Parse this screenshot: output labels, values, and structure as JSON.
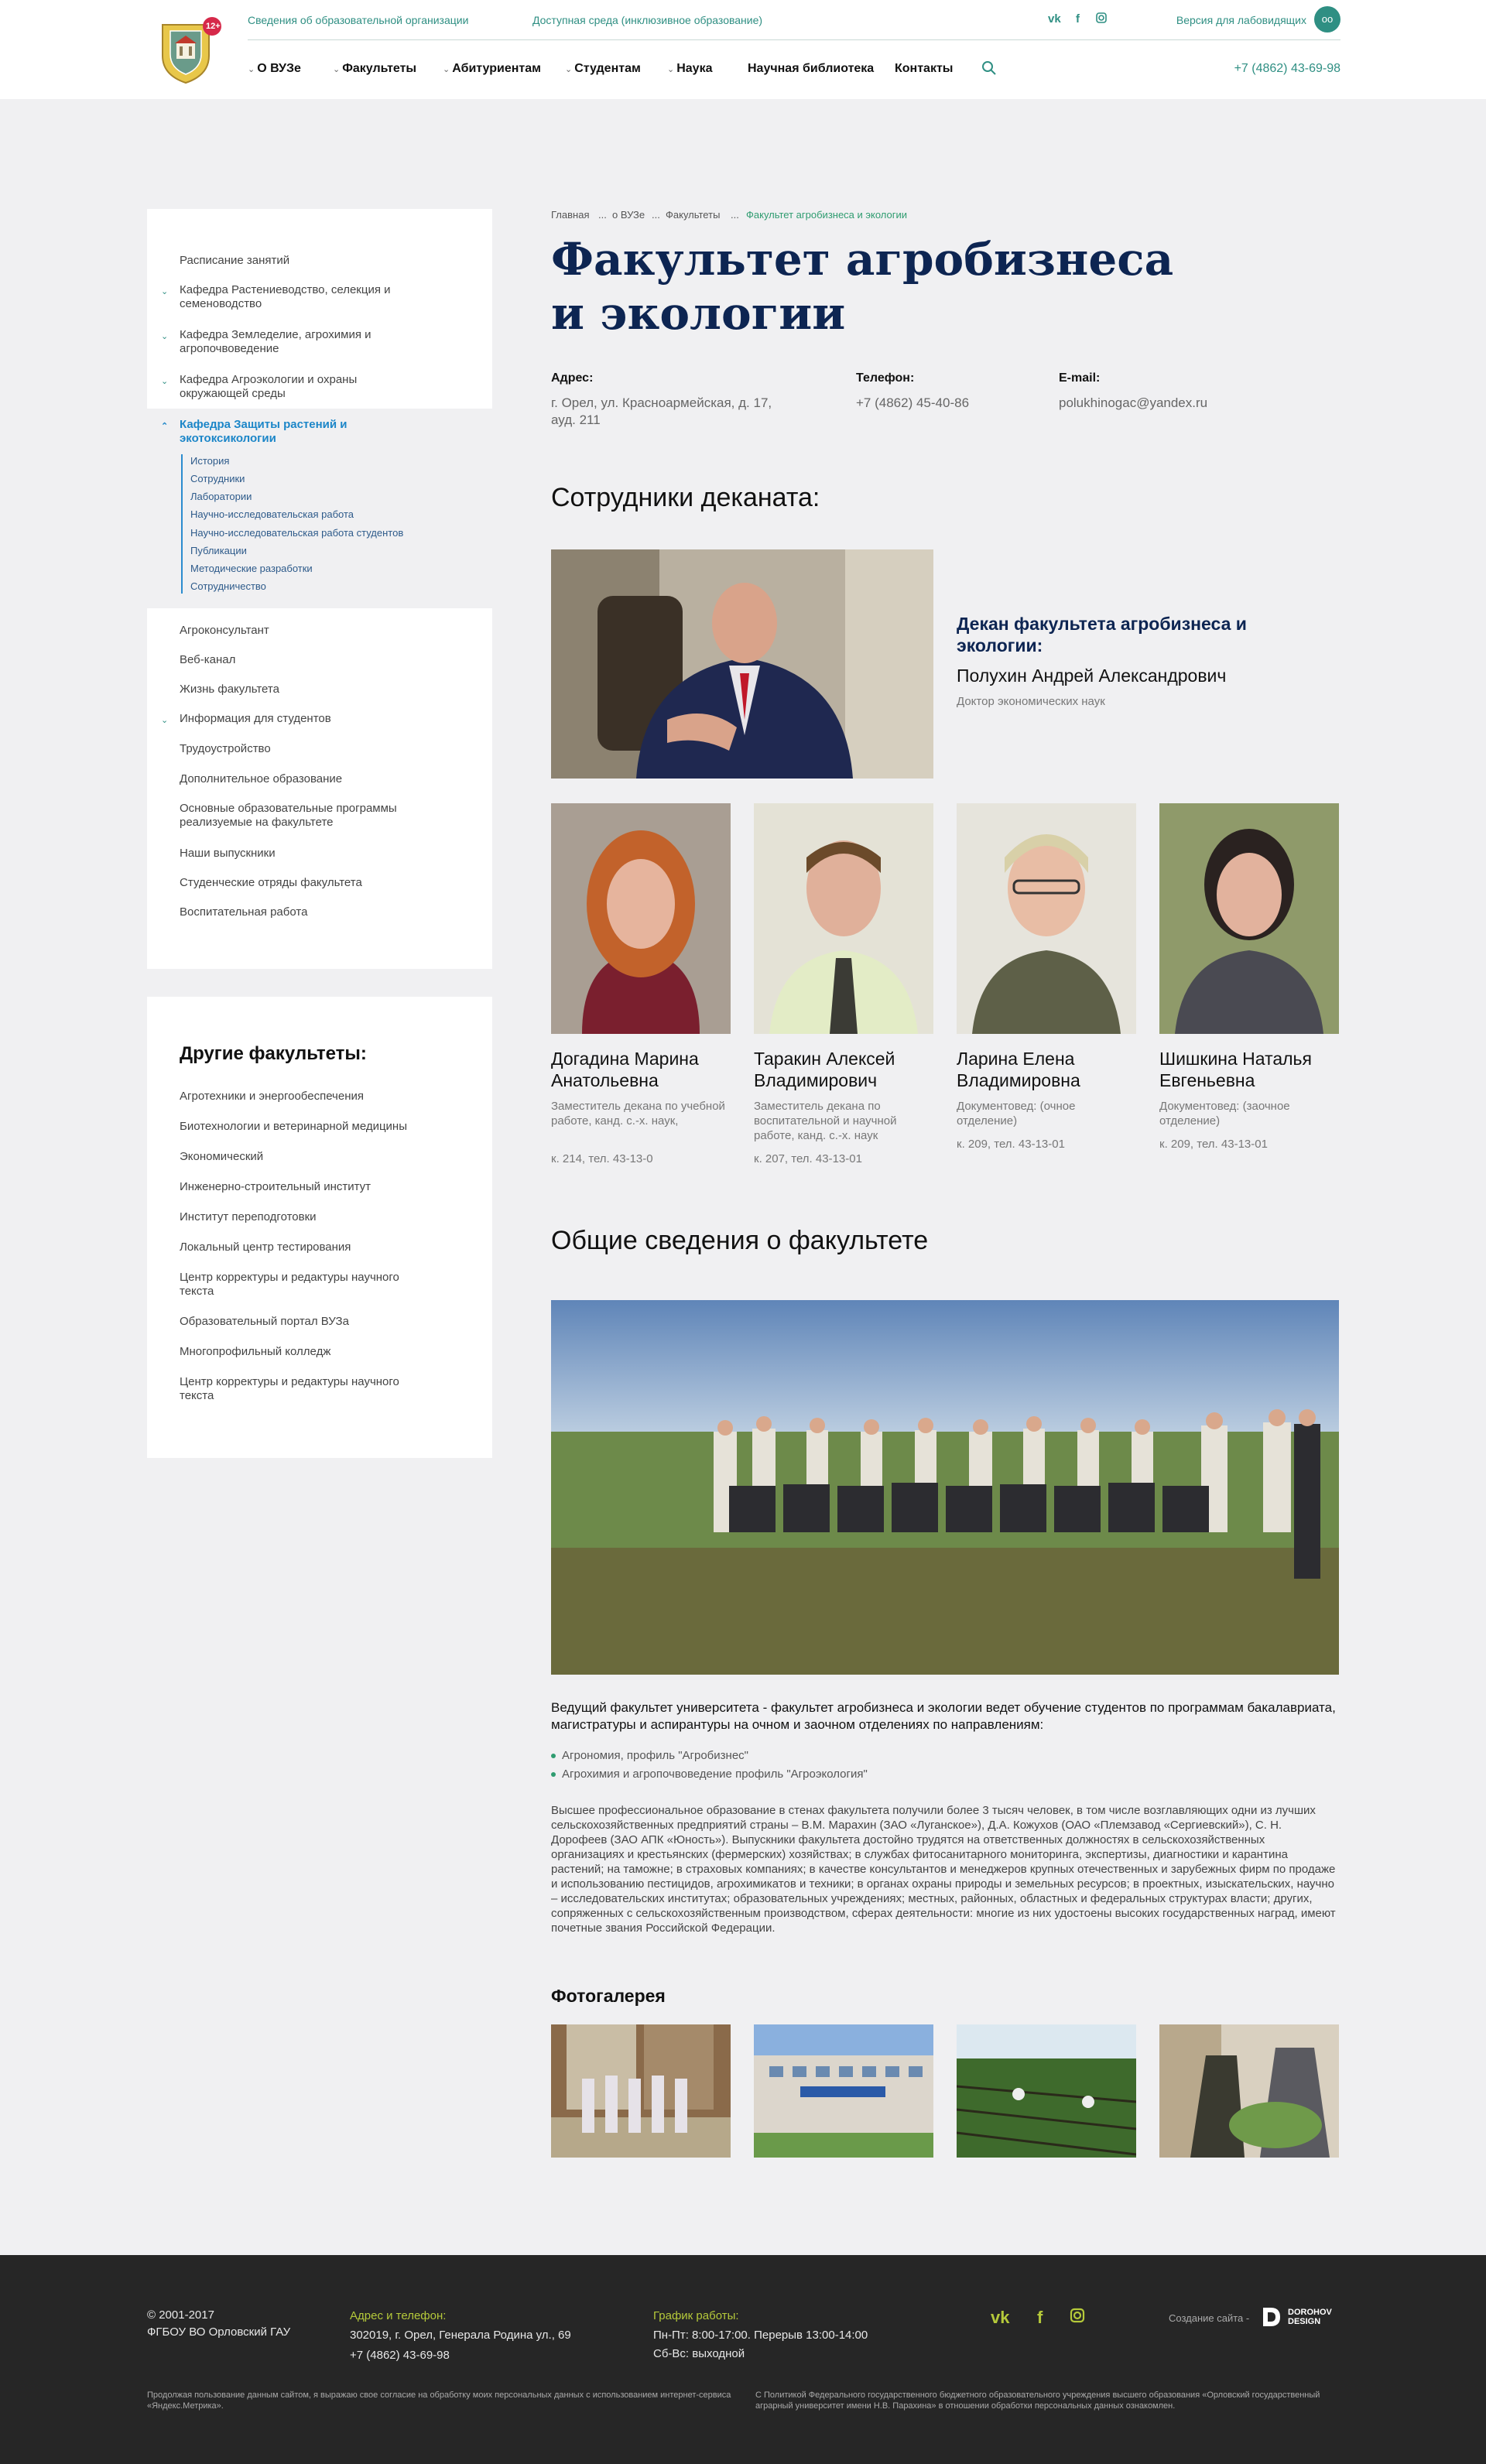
{
  "header": {
    "top_links": [
      "Сведения об образовательной организации",
      "Доступная среда (инклюзивное образование)"
    ],
    "social": [
      "vk",
      "f",
      "ig"
    ],
    "low_vision": "Версия для лабовидящих",
    "low_vision_icon": "glasses-icon",
    "logo_badge": "12+",
    "nav": [
      "О ВУЗе",
      "Факультеты",
      "Абитуриентам",
      "Студентам",
      "Наука",
      "Научная библиотека",
      "Контакты"
    ],
    "phone": "+7 (4862) 43-69-98"
  },
  "sidebar": {
    "items": [
      {
        "label": "Расписание занятий"
      },
      {
        "label": "Кафедра Растениеводство, селекция и семеноводство"
      },
      {
        "label": "Кафедра Земледелие, агрохимия и агропочвоведение"
      },
      {
        "label": "Кафедра Агроэкологии и охраны окружающей среды"
      },
      {
        "label": "Кафедра Защиты растений и экотоксикологии"
      }
    ],
    "subitems": [
      "История",
      "Сотрудники",
      "Лаборатории",
      "Научно-исследовательская работа",
      "Научно-исследовательская работа студентов",
      "Публикации",
      "Методические разработки",
      "Сотрудничество"
    ],
    "items2": [
      "Агроконсультант",
      "Веб-канал",
      "Жизнь факультета",
      "Информация для студентов",
      "Трудоустройство",
      "Дополнительное образование",
      "Основные образовательные программы реализуемые на факультете",
      "Наши выпускники",
      "Студенческие отряды факультета",
      "Воспитательная работа"
    ]
  },
  "other_faculties": {
    "title": "Другие факультеты:",
    "items": [
      "Агротехники и энергообеспечения",
      "Биотехнологии и ветеринарной медицины",
      "Экономический",
      "Инженерно-строительный институт",
      "Институт переподготовки",
      "Локальный центр тестирования",
      "Центр корректуры и редактуры научного текста",
      "Образовательный портал ВУЗа",
      "Многопрофильный колледж",
      "Центр корректуры и редактуры научного текста"
    ]
  },
  "breadcrumb": [
    "Главная",
    "о ВУЗе",
    "Факультеты",
    "Факультет агробизнеса и экологии"
  ],
  "breadcrumb_sep": "...",
  "title_line1": "Факультет агробизнеса",
  "title_line2": "и экологии",
  "contacts": {
    "address_label": "Адрес:",
    "address": "г. Орел, ул. Красноармейская, д. 17, ауд. 211",
    "phone_label": "Телефон:",
    "phone": "+7 (4862) 45-40-86",
    "email_label": "E-mail:",
    "email": "polukhinogac@yandex.ru"
  },
  "staff_title": "Сотрудники деканата:",
  "dean": {
    "role": "Декан факультета агробизнеса и экологии:",
    "name": "Полухин Андрей Александрович",
    "degree": "Доктор экономических наук"
  },
  "staff": [
    {
      "name": "Догадина Марина Анатольевна",
      "position": "Заместитель декана по учебной работе, канд. с.-х. наук,",
      "room": "к. 214, тел. 43-13-0"
    },
    {
      "name": "Таракин Алексей Владимирович",
      "position": "Заместитель декана по воспитательной и научной работе, канд. с.-х. наук",
      "room": "к. 207, тел. 43-13-01"
    },
    {
      "name": "Ларина Елена Владимировна",
      "position": "Документовед: (очное отделение)",
      "room": "к. 209, тел. 43-13-01"
    },
    {
      "name": "Шишкина Наталья Евгеньевна",
      "position": "Документовед: (заочное отделение)",
      "room": " к. 209, тел. 43-13-01"
    }
  ],
  "general_title": "Общие сведения о факультете",
  "general_intro": "Ведущий факультет университета - факультет агробизнеса и экологии ведет обучение студентов по программам бакалавриата,  магистратуры и аспирантуры на очном и заочном отделениях по направлениям:",
  "directions": [
    "Агрономия, профиль \"Агробизнес\"",
    "Агрохимия и агропочвоведение профиль \"Агроэкология\""
  ],
  "general_text": "Высшее профессиональное образование в стенах факультета получили более 3 тысяч человек, в том числе возглавляющих одни из лучших сельскохозяйственных предприятий страны – В.М. Марахин (ЗАО «Луганское»), Д.А. Кожухов (ОАО «Племзавод «Сергиевский»), С. Н. Дорофеев (ЗАО АПК «Юность»). Выпускники факультета достойно трудятся на ответственных должностях в сельскохозяйственных организациях и крестьянских (фермерских) хозяйствах; в службах фитосанитарного мониторинга, экспертизы, диагностики и карантина растений; на таможне; в страховых компаниях; в качестве консультантов и менеджеров крупных отечественных и зарубежных фирм по продаже и использованию пестицидов, агрохимикатов и техники; в органах охраны природы и земельных ресурсов; в проектных, изыскательских, научно – исследовательских институтах; образовательных учреждениях; местных, районных, областных и федеральных структурах власти; других, сопряженных с сельскохозяйственным производством, сферах деятельности: многие из них удостоены высоких государственных наград, имеют почетные звания Российской Федерации.",
  "gallery_title": "Фотогалерея",
  "footer": {
    "copyright": "© 2001-2017",
    "org": "ФГБОУ ВО Орловский ГАУ",
    "addr_label": "Адрес и телефон:",
    "addr": "302019, г. Орел, Генерала Родина ул., 69",
    "phone": "+7 (4862) 43-69-98",
    "hours_label": "График работы:",
    "hours1": "Пн-Пт:  8:00-17:00. Перерыв 13:00-14:00",
    "hours2": "Сб-Вс:  выходной",
    "dev": "Создание сайта -",
    "dev_name1": "DOROHOV",
    "dev_name2": "DESIGN",
    "note1": "Продолжая пользование данным сайтом, я выражаю свое согласие на обработку моих персональных данных с использованием интернет-сервиса «Яндекс.Метрика».",
    "note2": "С Политикой Федерального государственного бюджетного образовательного учреждения высшего образования «Орловский государственный аграрный университет имени Н.В. Парахина» в отношении обработки персональных данных ознакомлен."
  }
}
